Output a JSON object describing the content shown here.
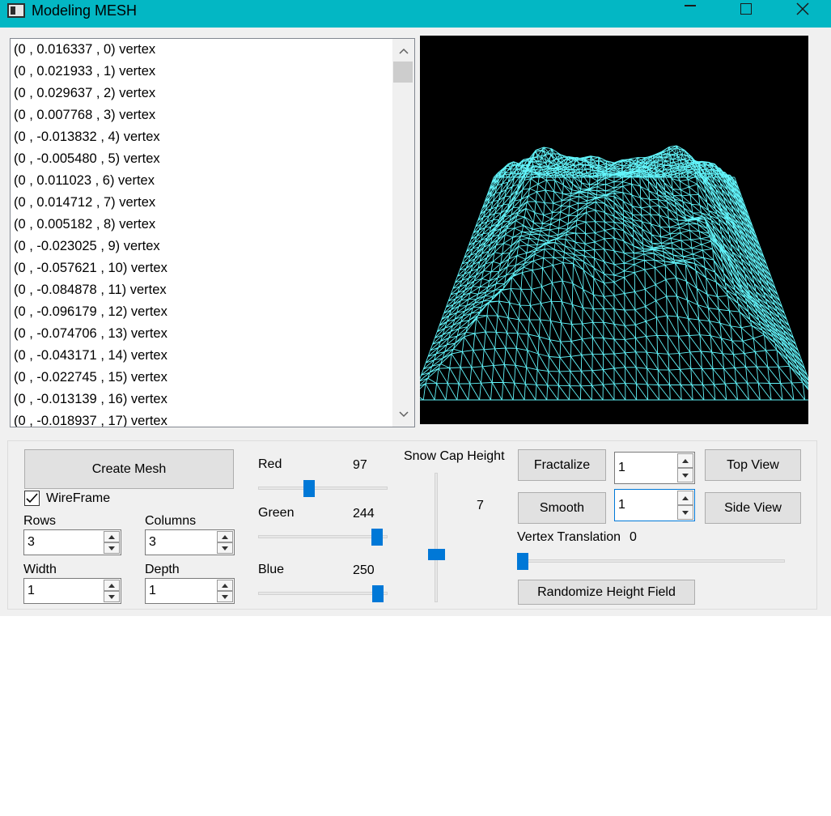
{
  "window": {
    "title": "Modeling MESH"
  },
  "vertex_list": {
    "items": [
      "(0 , 0.016337 , 0) vertex",
      "(0 , 0.021933 , 1) vertex",
      "(0 , 0.029637 , 2) vertex",
      "(0 , 0.007768 , 3) vertex",
      "(0 , -0.013832 , 4) vertex",
      "(0 , -0.005480 , 5) vertex",
      "(0 , 0.011023 , 6) vertex",
      "(0 , 0.014712 , 7) vertex",
      "(0 , 0.005182 , 8) vertex",
      "(0 , -0.023025 , 9) vertex",
      "(0 , -0.057621 , 10) vertex",
      "(0 , -0.084878 , 11) vertex",
      "(0 , -0.096179 , 12) vertex",
      "(0 , -0.074706 , 13) vertex",
      "(0 , -0.043171 , 14) vertex",
      "(0 , -0.022745 , 15) vertex",
      "(0 , -0.013139 , 16) vertex",
      "(0 , -0.018937 , 17) vertex"
    ]
  },
  "viewport": {
    "background": "#000000",
    "mesh_color": "#61f4fa"
  },
  "controls": {
    "create_mesh_label": "Create Mesh",
    "wireframe_label": "WireFrame",
    "wireframe_checked": true,
    "rows_label": "Rows",
    "rows_value": "3",
    "columns_label": "Columns",
    "columns_value": "3",
    "width_label": "Width",
    "width_value": "1",
    "depth_label": "Depth",
    "depth_value": "1"
  },
  "color_sliders": {
    "red_label": "Red",
    "red_value": "97",
    "green_label": "Green",
    "green_value": "244",
    "blue_label": "Blue",
    "blue_value": "250",
    "max": 255
  },
  "snow_cap": {
    "label": "Snow Cap Height",
    "value": "7"
  },
  "actions": {
    "fractalize_label": "Fractalize",
    "fractalize_value": "1",
    "smooth_label": "Smooth",
    "smooth_value": "1",
    "top_view_label": "Top View",
    "side_view_label": "Side View",
    "vertex_translation_label": "Vertex Translation",
    "vertex_translation_value": "0",
    "randomize_label": "Randomize Height Field"
  }
}
